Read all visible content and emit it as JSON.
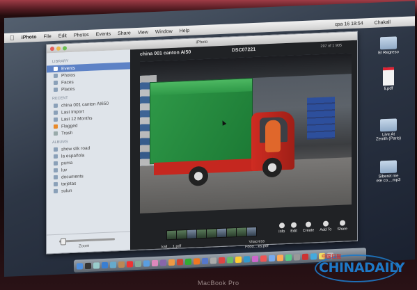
{
  "menubar": {
    "app": "iPhoto",
    "items": [
      "File",
      "Edit",
      "Photos",
      "Events",
      "Share",
      "View",
      "Window",
      "Help"
    ],
    "status": [
      "qsa 16 18:54",
      "Chakall"
    ]
  },
  "window": {
    "title": "iPhoto"
  },
  "sidebar": {
    "library_header": "LIBRARY",
    "library": [
      "Events",
      "Photos",
      "Faces",
      "Places"
    ],
    "recent_header": "RECENT",
    "recent": [
      "china 001 canton AI650",
      "Last Import",
      "Last 12 Months",
      "Flagged",
      "Trash"
    ],
    "albums_header": "ALBUMS",
    "albums": [
      "show slik road",
      "la española",
      "puma",
      "luv",
      "documents",
      "tarjetas",
      "sulun"
    ],
    "zoom_label": "Zoom"
  },
  "viewer": {
    "event_title": "china 001 canton AI50",
    "photo_name": "DSC07221",
    "counter": "297 of 1 905"
  },
  "toolbar": [
    "Info",
    "Edit",
    "Create",
    "Add To",
    "Share"
  ],
  "captions": {
    "left": "kall_...1.pdf",
    "right": "Vitacress\nFood....es.pdf"
  },
  "desktop": [
    {
      "label": "El Regreso"
    },
    {
      "label": "li.pdf"
    },
    {
      "label": "Live At\nZenith (Paris)"
    },
    {
      "label": "Siberet me\nete co....mp3"
    }
  ],
  "hardware": {
    "model": "MacBook Pro"
  },
  "watermark": {
    "text": "CHINADAILY",
    "cn": "中国日报"
  }
}
